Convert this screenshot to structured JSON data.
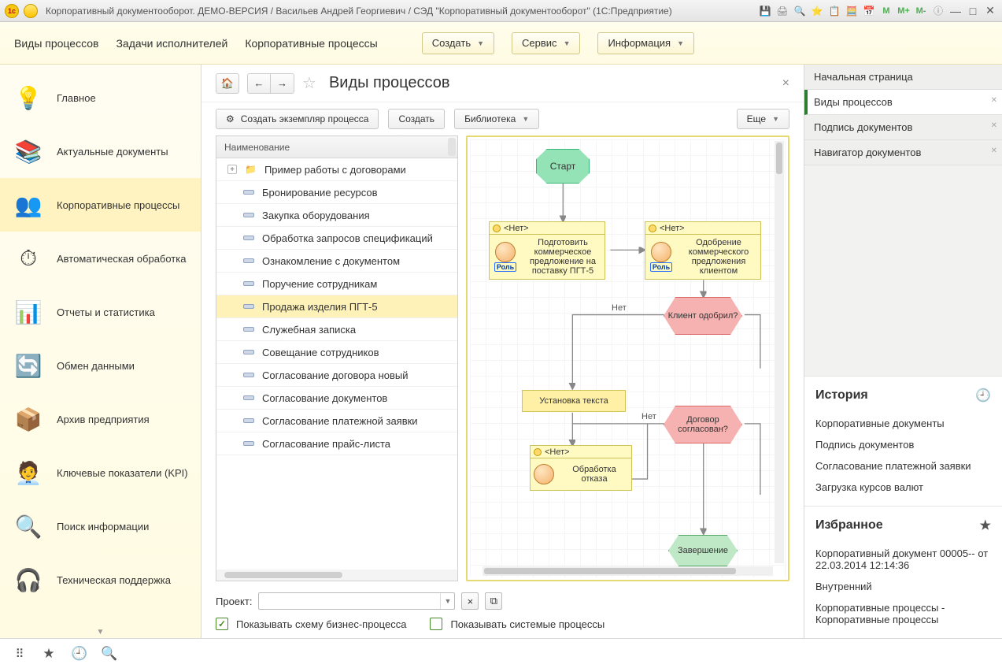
{
  "titlebar": {
    "title": "Корпоративный документооборот. ДЕМО-ВЕРСИЯ / Васильев Андрей Георгиевич / СЭД \"Корпоративный документооборот\"  (1С:Предприятие)",
    "m1": "M",
    "m2": "M+",
    "m3": "M-"
  },
  "menubar": {
    "links": [
      "Виды процессов",
      "Задачи исполнителей",
      "Корпоративные процессы"
    ],
    "buttons": {
      "create": "Создать",
      "service": "Сервис",
      "info": "Информация"
    }
  },
  "leftnav": {
    "items": [
      {
        "label": "Главное",
        "icon": "💡"
      },
      {
        "label": "Актуальные документы",
        "icon": "📚"
      },
      {
        "label": "Корпоративные процессы",
        "icon": "👥",
        "active": true
      },
      {
        "label": "Автоматическая обработка",
        "icon": "⏱"
      },
      {
        "label": "Отчеты и статистика",
        "icon": "📊"
      },
      {
        "label": "Обмен данными",
        "icon": "🔄"
      },
      {
        "label": "Архив предприятия",
        "icon": "📦"
      },
      {
        "label": "Ключевые показатели (KPI)",
        "icon": "🧑‍💼"
      },
      {
        "label": "Поиск информации",
        "icon": "🔍"
      },
      {
        "label": "Техническая поддержка",
        "icon": "🎧"
      }
    ]
  },
  "center": {
    "title": "Виды процессов",
    "toolbar": {
      "create_instance": "Создать экземпляр процесса",
      "create": "Создать",
      "library": "Библиотека",
      "more": "Еще"
    },
    "list_header": "Наименование",
    "rows": [
      {
        "type": "folder",
        "label": "Пример работы с договорами"
      },
      {
        "type": "leaf",
        "label": "Бронирование ресурсов"
      },
      {
        "type": "leaf",
        "label": "Закупка оборудования"
      },
      {
        "type": "leaf",
        "label": "Обработка запросов спецификаций"
      },
      {
        "type": "leaf",
        "label": "Ознакомление с документом"
      },
      {
        "type": "leaf",
        "label": "Поручение сотрудникам"
      },
      {
        "type": "leaf",
        "label": "Продажа изделия ПГТ-5",
        "selected": true
      },
      {
        "type": "leaf",
        "label": "Служебная записка"
      },
      {
        "type": "leaf",
        "label": "Совещание сотрудников"
      },
      {
        "type": "leaf",
        "label": "Согласование договора новый"
      },
      {
        "type": "leaf",
        "label": "Согласование документов"
      },
      {
        "type": "leaf",
        "label": "Согласование платежной заявки"
      },
      {
        "type": "leaf",
        "label": "Согласование прайс-листа"
      }
    ],
    "project_label": "Проект:",
    "chk1": "Показывать схему бизнес-процесса",
    "chk2": "Показывать системые процессы"
  },
  "diagram": {
    "start": "Старт",
    "task1_top": "<Нет>",
    "task1": "Подготовить коммерческое предложение на поставку ПГТ-5",
    "task2_top": "<Нет>",
    "task2": "Одобрение коммерческого предложения клиентом",
    "role": "Роль",
    "dec1": "Клиент одобрил?",
    "dec2": "Договор согласован?",
    "no": "Нет",
    "set": "Установка текста",
    "task3_top": "<Нет>",
    "task3": "Обработка отказа",
    "end": "Завершение"
  },
  "right": {
    "tabs": [
      "Начальная страница",
      "Виды процессов",
      "Подпись документов",
      "Навигатор документов"
    ],
    "history": {
      "title": "История",
      "items": [
        "Корпоративные документы",
        "Подпись документов",
        "Согласование платежной заявки",
        "Загрузка курсов валют"
      ]
    },
    "fav": {
      "title": "Избранное",
      "items": [
        "Корпоративный документ 00005-- от 22.03.2014 12:14:36",
        "Внутренний",
        "Корпоративные процессы - Корпоративные процессы"
      ]
    }
  }
}
